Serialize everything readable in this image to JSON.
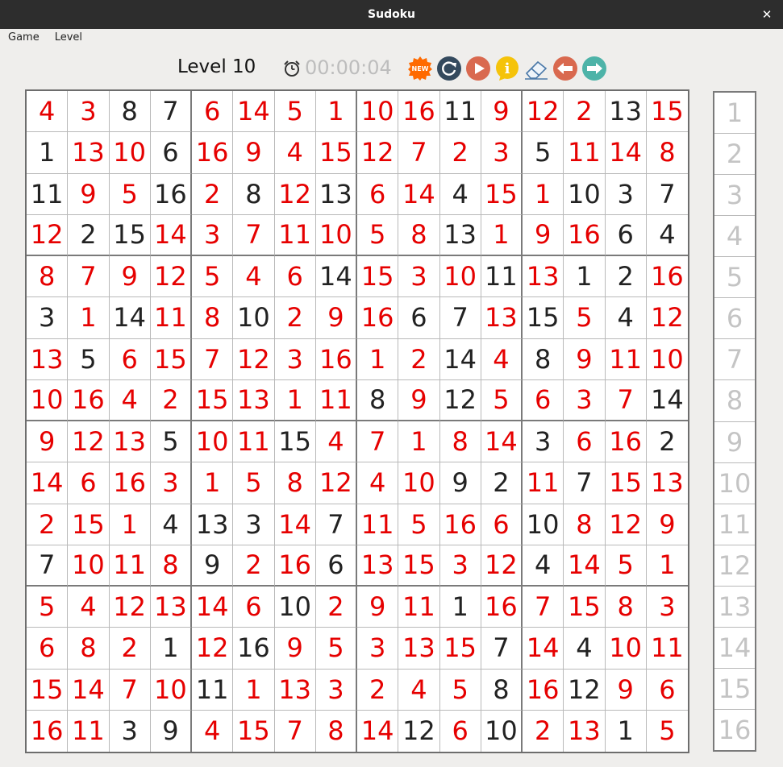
{
  "window": {
    "title": "Sudoku",
    "close_glyph": "✕"
  },
  "menu": [
    {
      "label": "Game"
    },
    {
      "label": "Level"
    }
  ],
  "toolbar": {
    "level_label": "Level 10",
    "timer": "00:00:04",
    "icons": [
      "clock-icon",
      "new-game-icon",
      "restart-icon",
      "play-icon",
      "info-icon",
      "eraser-icon",
      "undo-icon",
      "redo-icon"
    ],
    "new_badge_text": "NEW",
    "info_glyph": "i"
  },
  "colors": {
    "given_digit": "#222222",
    "entered_digit": "#e60000",
    "palette_digit": "#c4c4c4",
    "new_icon": "#ff6a00",
    "restart_icon": "#344a5e",
    "play_icon": "#d9694f",
    "info_icon": "#f5c30a",
    "undo_icon": "#d9694f",
    "redo_icon": "#4db3a8"
  },
  "board": {
    "values": [
      [
        4,
        3,
        8,
        7,
        6,
        14,
        5,
        1,
        10,
        16,
        11,
        9,
        12,
        2,
        13,
        15
      ],
      [
        1,
        13,
        10,
        6,
        16,
        9,
        4,
        15,
        12,
        7,
        2,
        3,
        5,
        11,
        14,
        8
      ],
      [
        11,
        9,
        5,
        16,
        2,
        8,
        12,
        13,
        6,
        14,
        4,
        15,
        1,
        10,
        3,
        7
      ],
      [
        12,
        2,
        15,
        14,
        3,
        7,
        11,
        10,
        5,
        8,
        13,
        1,
        9,
        16,
        6,
        4
      ],
      [
        8,
        7,
        9,
        12,
        5,
        4,
        6,
        14,
        15,
        3,
        10,
        11,
        13,
        1,
        2,
        16
      ],
      [
        3,
        1,
        14,
        11,
        8,
        10,
        2,
        9,
        16,
        6,
        7,
        13,
        15,
        5,
        4,
        12
      ],
      [
        13,
        5,
        6,
        15,
        7,
        12,
        3,
        16,
        1,
        2,
        14,
        4,
        8,
        9,
        11,
        10
      ],
      [
        10,
        16,
        4,
        2,
        15,
        13,
        1,
        11,
        8,
        9,
        12,
        5,
        6,
        3,
        7,
        14
      ],
      [
        9,
        12,
        13,
        5,
        10,
        11,
        15,
        4,
        7,
        1,
        8,
        14,
        3,
        6,
        16,
        2
      ],
      [
        14,
        6,
        16,
        3,
        1,
        5,
        8,
        12,
        4,
        10,
        9,
        2,
        11,
        7,
        15,
        13
      ],
      [
        2,
        15,
        1,
        4,
        13,
        3,
        14,
        7,
        11,
        5,
        16,
        6,
        10,
        8,
        12,
        9
      ],
      [
        7,
        10,
        11,
        8,
        9,
        2,
        16,
        6,
        13,
        15,
        3,
        12,
        4,
        14,
        5,
        1
      ],
      [
        5,
        4,
        12,
        13,
        14,
        6,
        10,
        2,
        9,
        11,
        1,
        16,
        7,
        15,
        8,
        3
      ],
      [
        6,
        8,
        2,
        1,
        12,
        16,
        9,
        5,
        3,
        13,
        15,
        7,
        14,
        4,
        10,
        11
      ],
      [
        15,
        14,
        7,
        10,
        11,
        1,
        13,
        3,
        2,
        4,
        5,
        8,
        16,
        12,
        9,
        6
      ],
      [
        16,
        11,
        3,
        9,
        4,
        15,
        7,
        8,
        14,
        12,
        6,
        10,
        2,
        13,
        1,
        5
      ]
    ],
    "given_mask": [
      "0011000000100010",
      "1001000000001000",
      "1001010100100111",
      "0110000000100011",
      "0000000100010110",
      "1010010001101010",
      "0100000000101000",
      "0000000010100001",
      "0001001000001001",
      "0000000000110100",
      "0001110100001000",
      "1000100100001000",
      "0000001000100000",
      "0001010000010100",
      "0000100000010100",
      "0011000001010010"
    ]
  },
  "palette": [
    "1",
    "2",
    "3",
    "4",
    "5",
    "6",
    "7",
    "8",
    "9",
    "10",
    "11",
    "12",
    "13",
    "14",
    "15",
    "16"
  ]
}
